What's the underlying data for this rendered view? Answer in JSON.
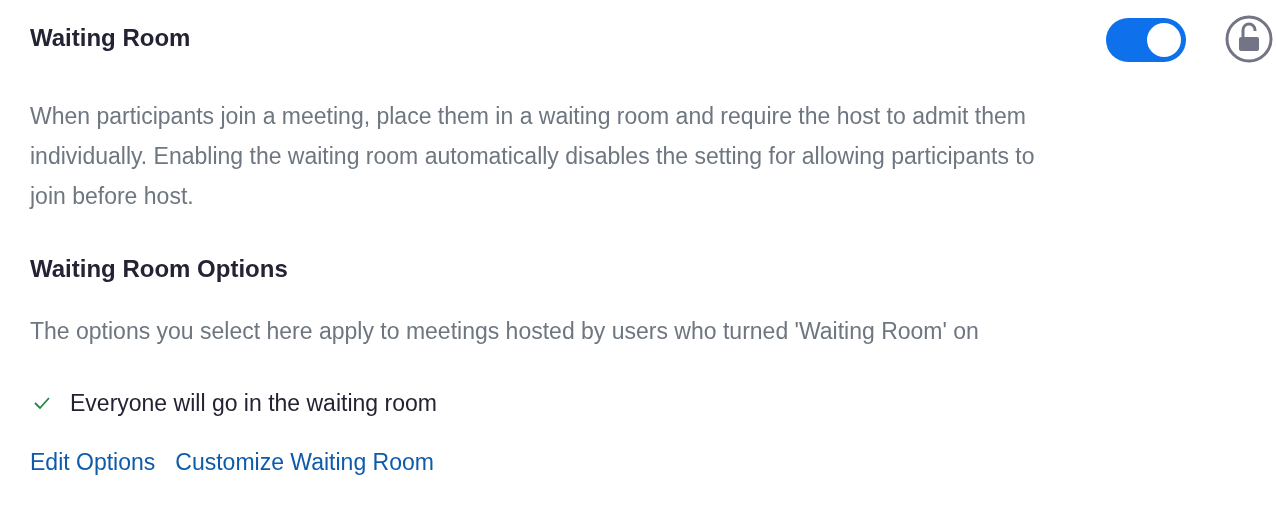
{
  "setting": {
    "title": "Waiting Room",
    "on": true,
    "locked": false,
    "description": "When participants join a meeting, place them in a waiting room and require the host to admit them individually. Enabling the waiting room automatically disables the setting for allowing participants to join before host."
  },
  "options": {
    "title": "Waiting Room Options",
    "description": "The options you select here apply to meetings hosted by users who turned 'Waiting Room' on",
    "items": [
      {
        "label": "Everyone will go in the waiting room",
        "checked": true
      }
    ],
    "links": [
      "Edit Options",
      "Customize Waiting Room"
    ]
  }
}
